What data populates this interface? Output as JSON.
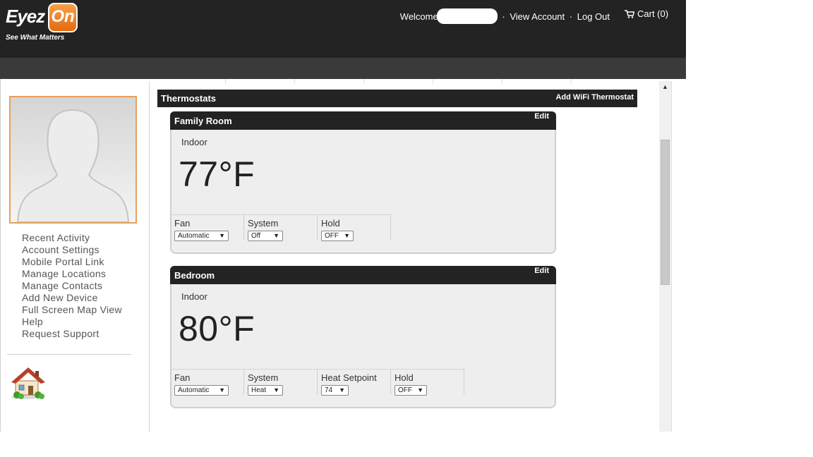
{
  "brand": {
    "logo_eyez": "Eyez",
    "logo_on": "On",
    "tagline": "See What Matters"
  },
  "topnav": {
    "welcome": "Welcome",
    "view_account": "View Account",
    "separator": "·",
    "logout": "Log Out",
    "cart": "Cart (0)"
  },
  "sidebar": {
    "items": [
      {
        "label": "Recent Activity"
      },
      {
        "label": "Account Settings"
      },
      {
        "label": "Mobile Portal Link"
      },
      {
        "label": "Manage Locations"
      },
      {
        "label": "Manage Contacts"
      },
      {
        "label": "Add New Device"
      },
      {
        "label": "Full Screen Map View"
      },
      {
        "label": "Help"
      },
      {
        "label": "Request Support"
      }
    ]
  },
  "main": {
    "section_title": "Thermostats",
    "add_button": "Add WiFi Thermostat",
    "cards": [
      {
        "name": "Family Room",
        "edit": "Edit",
        "indoor_label": "Indoor",
        "temperature": "77°F",
        "controls": [
          {
            "label": "Fan",
            "value": "Automatic"
          },
          {
            "label": "System",
            "value": "Off"
          },
          {
            "label": "Hold",
            "value": "OFF"
          }
        ]
      },
      {
        "name": "Bedroom",
        "edit": "Edit",
        "indoor_label": "Indoor",
        "temperature": "80°F",
        "controls": [
          {
            "label": "Fan",
            "value": "Automatic"
          },
          {
            "label": "System",
            "value": "Heat"
          },
          {
            "label": "Heat Setpoint",
            "value": "74"
          },
          {
            "label": "Hold",
            "value": "OFF"
          }
        ]
      }
    ]
  },
  "icons": {
    "cart": "cart-icon",
    "avatar": "user-silhouette-icon",
    "location": "house-icon",
    "dropdown": "chevron-down-icon",
    "scroll_up": "scroll-up-arrow-icon"
  },
  "colors": {
    "header": "#232323",
    "navbar": "#3a3a3a",
    "logo_accent": "#e56a0e",
    "avatar_border": "#e8a05a",
    "card_bg": "#eeeeee"
  }
}
